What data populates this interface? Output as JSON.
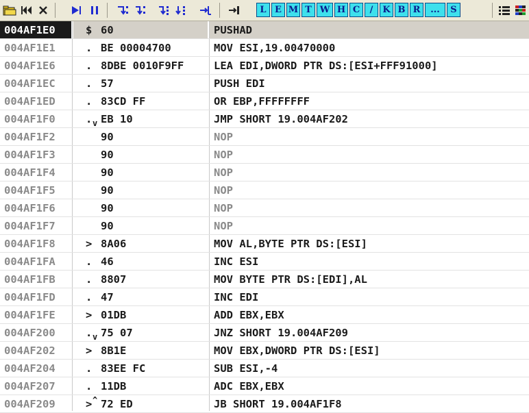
{
  "toolbar": {
    "letters": [
      "L",
      "E",
      "M",
      "T",
      "W",
      "H",
      "C",
      "/",
      "K",
      "B",
      "R",
      "...",
      "S"
    ]
  },
  "rows": [
    {
      "addr": "004AF1E0",
      "mark": "$",
      "hex": "60",
      "dis": "PUSHAD",
      "sel": true
    },
    {
      "addr": "004AF1E1",
      "mark": ".",
      "hex": "BE 00004700",
      "dis": "MOV ESI,19.00470000"
    },
    {
      "addr": "004AF1E6",
      "mark": ".",
      "hex": "8DBE 0010F9FF",
      "dis": "LEA EDI,DWORD PTR DS:[ESI+FFF91000]"
    },
    {
      "addr": "004AF1EC",
      "mark": ".",
      "hex": "57",
      "dis": "PUSH EDI"
    },
    {
      "addr": "004AF1ED",
      "mark": ".",
      "hex": "83CD FF",
      "dis": "OR EBP,FFFFFFFF"
    },
    {
      "addr": "004AF1F0",
      "mark": ".",
      "hex": "EB 10",
      "dis": "JMP SHORT 19.004AF202",
      "jump": "down"
    },
    {
      "addr": "004AF1F2",
      "mark": "",
      "hex": "90",
      "dis": "NOP",
      "nop": true
    },
    {
      "addr": "004AF1F3",
      "mark": "",
      "hex": "90",
      "dis": "NOP",
      "nop": true
    },
    {
      "addr": "004AF1F4",
      "mark": "",
      "hex": "90",
      "dis": "NOP",
      "nop": true
    },
    {
      "addr": "004AF1F5",
      "mark": "",
      "hex": "90",
      "dis": "NOP",
      "nop": true
    },
    {
      "addr": "004AF1F6",
      "mark": "",
      "hex": "90",
      "dis": "NOP",
      "nop": true
    },
    {
      "addr": "004AF1F7",
      "mark": "",
      "hex": "90",
      "dis": "NOP",
      "nop": true
    },
    {
      "addr": "004AF1F8",
      "mark": ">",
      "hex": "8A06",
      "dis": "MOV AL,BYTE PTR DS:[ESI]"
    },
    {
      "addr": "004AF1FA",
      "mark": ".",
      "hex": "46",
      "dis": "INC ESI"
    },
    {
      "addr": "004AF1FB",
      "mark": ".",
      "hex": "8807",
      "dis": "MOV BYTE PTR DS:[EDI],AL"
    },
    {
      "addr": "004AF1FD",
      "mark": ".",
      "hex": "47",
      "dis": "INC EDI"
    },
    {
      "addr": "004AF1FE",
      "mark": ">",
      "hex": "01DB",
      "dis": "ADD EBX,EBX"
    },
    {
      "addr": "004AF200",
      "mark": ".",
      "hex": "75 07",
      "dis": "JNZ SHORT 19.004AF209",
      "jump": "down"
    },
    {
      "addr": "004AF202",
      "mark": ">",
      "hex": "8B1E",
      "dis": "MOV EBX,DWORD PTR DS:[ESI]"
    },
    {
      "addr": "004AF204",
      "mark": ".",
      "hex": "83EE FC",
      "dis": "SUB ESI,-4"
    },
    {
      "addr": "004AF207",
      "mark": ".",
      "hex": "11DB",
      "dis": "ADC EBX,EBX"
    },
    {
      "addr": "004AF209",
      "mark": ">",
      "hex": "72 ED",
      "dis": "JB SHORT 19.004AF1F8",
      "jump": "up"
    }
  ]
}
